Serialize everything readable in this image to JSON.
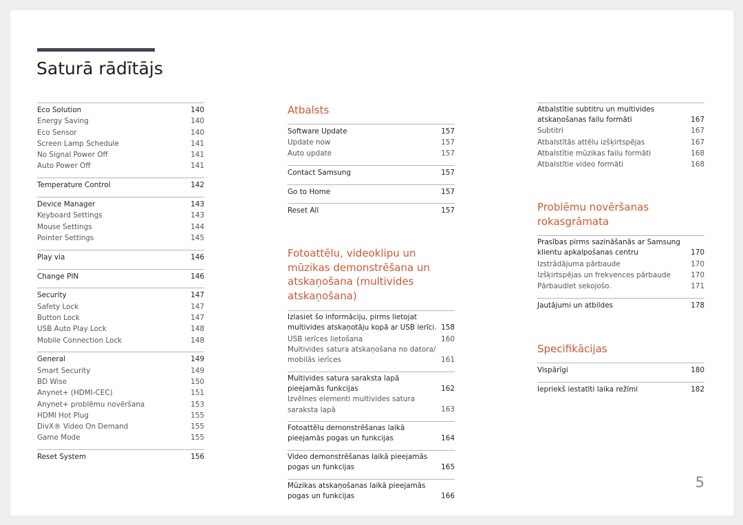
{
  "title": "Saturā rādītājs",
  "page_number": "5",
  "colors": {
    "accent": "#cc5a32",
    "title_bar": "#45414f",
    "background": "#eeeeee"
  },
  "left_column": {
    "groups": [
      {
        "items": [
          {
            "label": "Eco Solution",
            "page": "140",
            "main": true
          },
          {
            "label": "Energy Saving",
            "page": "140"
          },
          {
            "label": "Eco Sensor",
            "page": "140"
          },
          {
            "label": "Screen Lamp Schedule",
            "page": "141"
          },
          {
            "label": "No Signal Power Off",
            "page": "141"
          },
          {
            "label": "Auto Power Off",
            "page": "141"
          }
        ]
      },
      {
        "items": [
          {
            "label": "Temperature Control",
            "page": "142",
            "main": true
          }
        ]
      },
      {
        "items": [
          {
            "label": "Device Manager",
            "page": "143",
            "main": true
          },
          {
            "label": "Keyboard Settings",
            "page": "143"
          },
          {
            "label": "Mouse Settings",
            "page": "144"
          },
          {
            "label": "Pointer Settings",
            "page": "145"
          }
        ]
      },
      {
        "items": [
          {
            "label": "Play via",
            "page": "146",
            "main": true
          }
        ]
      },
      {
        "items": [
          {
            "label": "Change PIN",
            "page": "146",
            "main": true
          }
        ]
      },
      {
        "items": [
          {
            "label": "Security",
            "page": "147",
            "main": true
          },
          {
            "label": "Safety Lock",
            "page": "147"
          },
          {
            "label": "Button Lock",
            "page": "147"
          },
          {
            "label": "USB Auto Play Lock",
            "page": "148"
          },
          {
            "label": "Mobile Connection Lock",
            "page": "148"
          }
        ]
      },
      {
        "items": [
          {
            "label": "General",
            "page": "149",
            "main": true
          },
          {
            "label": "Smart Security",
            "page": "149"
          },
          {
            "label": "BD Wise",
            "page": "150"
          },
          {
            "label": "Anynet+ (HDMI-CEC)",
            "page": "151"
          },
          {
            "label": "Anynet+ problēmu novēršana",
            "page": "153"
          },
          {
            "label": "HDMI Hot Plug",
            "page": "155"
          },
          {
            "label": "DivX® Video On Demand",
            "page": "155"
          },
          {
            "label": "Game Mode",
            "page": "155"
          }
        ]
      },
      {
        "items": [
          {
            "label": "Reset System",
            "page": "156",
            "main": true
          }
        ]
      }
    ]
  },
  "middle_column": {
    "sections": [
      {
        "heading": "Atbalsts",
        "groups": [
          {
            "items": [
              {
                "label": "Software Update",
                "page": "157",
                "main": true
              },
              {
                "label": "Update now",
                "page": "157"
              },
              {
                "label": "Auto update",
                "page": "157"
              }
            ]
          },
          {
            "items": [
              {
                "label": "Contact Samsung",
                "page": "157",
                "main": true
              }
            ]
          },
          {
            "items": [
              {
                "label": "Go to Home",
                "page": "157",
                "main": true
              }
            ]
          },
          {
            "items": [
              {
                "label": "Reset All",
                "page": "157",
                "main": true
              }
            ]
          }
        ]
      },
      {
        "heading": "Fotoattēlu, videoklipu un mūzikas demonstrēšana un atskaņošana (multivides atskaņošana)",
        "groups": [
          {
            "items": [
              {
                "label": "Izlasiet šo informāciju, pirms lietojat multivides atskaņotāju kopā ar USB ierīci.",
                "page": "158",
                "main": true
              },
              {
                "label": "USB ierīces lietošana",
                "page": "160"
              },
              {
                "label": "Multivides satura atskaņošana no datora/ mobilās ierīces",
                "page": "161"
              }
            ]
          },
          {
            "items": [
              {
                "label": "Multivides satura saraksta lapā pieejamās funkcijas",
                "page": "162",
                "main": true
              },
              {
                "label": "Izvēlnes elementi multivides satura saraksta lapā",
                "page": "163"
              }
            ]
          },
          {
            "items": [
              {
                "label": "Fotoattēlu demonstrēšanas laikā pieejamās pogas un funkcijas",
                "page": "164",
                "main": true
              }
            ]
          },
          {
            "items": [
              {
                "label": "Video demonstrēšanas laikā pieejamās pogas un funkcijas",
                "page": "165",
                "main": true
              }
            ]
          },
          {
            "items": [
              {
                "label": "Mūzikas atskaņošanas laikā pieejamās pogas un funkcijas",
                "page": "166",
                "main": true
              }
            ]
          }
        ]
      }
    ]
  },
  "right_column": {
    "sections": [
      {
        "heading": "",
        "groups": [
          {
            "items": [
              {
                "label": "Atbalstītie subtitru un multivides atskaņošanas failu formāti",
                "page": "167",
                "main": true
              },
              {
                "label": "Subtitri",
                "page": "167"
              },
              {
                "label": "Atbalstītās attēlu izšķirtspējas",
                "page": "167"
              },
              {
                "label": "Atbalstītie mūzikas failu formāti",
                "page": "168"
              },
              {
                "label": "Atbalstītie video formāti",
                "page": "168"
              }
            ]
          }
        ]
      },
      {
        "heading": "Problēmu novēršanas rokasgrāmata",
        "groups": [
          {
            "items": [
              {
                "label": "Prasības pirms sazināšanās ar Samsung klientu apkalpošanas centru",
                "page": "170",
                "main": true
              },
              {
                "label": "Izstrādājuma pārbaude",
                "page": "170"
              },
              {
                "label": "Izšķirtspējas un frekvences pārbaude",
                "page": "170"
              },
              {
                "label": "Pārbaudiet sekojošo.",
                "page": "171"
              }
            ]
          },
          {
            "items": [
              {
                "label": "Jautājumi un atbildes",
                "page": "178",
                "main": true
              }
            ]
          }
        ]
      },
      {
        "heading": "Specifikācijas",
        "groups": [
          {
            "items": [
              {
                "label": "Vispārīgi",
                "page": "180",
                "main": true
              }
            ]
          },
          {
            "items": [
              {
                "label": "Iepriekš iestatīti laika režīmi",
                "page": "182",
                "main": true
              }
            ]
          }
        ]
      }
    ]
  }
}
